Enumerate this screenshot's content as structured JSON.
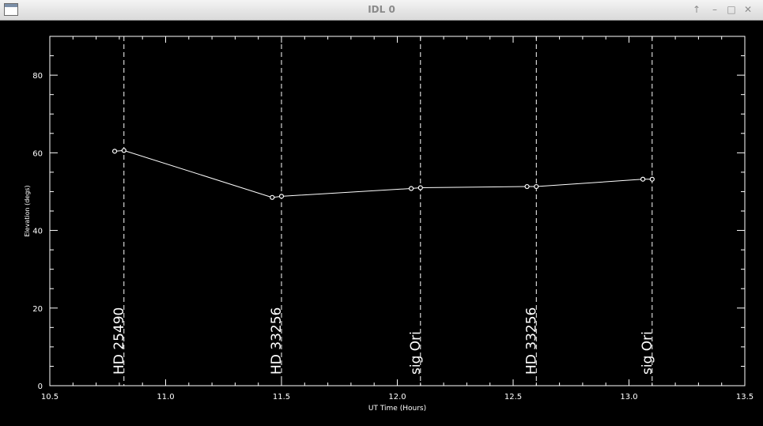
{
  "window": {
    "title": "IDL 0",
    "controls": {
      "up": "↑",
      "minimize": "–",
      "maximize": "□",
      "close": "✕"
    }
  },
  "chart_data": {
    "type": "line",
    "xlabel": "UT Time (Hours)",
    "ylabel": "Elevation (degs)",
    "xlim": [
      10.5,
      13.5
    ],
    "ylim": [
      0,
      90
    ],
    "x_ticks": [
      10.5,
      11.0,
      11.5,
      12.0,
      12.5,
      13.0,
      13.5
    ],
    "x_tick_labels": [
      "10.5",
      "11.0",
      "11.5",
      "12.0",
      "12.5",
      "13.0",
      "13.5"
    ],
    "y_ticks": [
      0,
      20,
      40,
      60,
      80
    ],
    "y_tick_labels": [
      "0",
      "20",
      "40",
      "60",
      "80"
    ],
    "grid": false,
    "background": "#000000",
    "foreground": "#ffffff",
    "series": [
      {
        "x": [
          10.78,
          10.82,
          11.46,
          11.5,
          12.06,
          12.1,
          12.56,
          12.6,
          13.06,
          13.1
        ],
        "y": [
          60.4,
          60.6,
          48.5,
          48.8,
          50.8,
          51.0,
          51.3,
          51.3,
          53.2,
          53.2
        ]
      }
    ],
    "annotations": [
      {
        "x": 10.82,
        "label": "HD 25490"
      },
      {
        "x": 11.5,
        "label": "HD 33256"
      },
      {
        "x": 12.1,
        "label": "sig Ori"
      },
      {
        "x": 12.6,
        "label": "HD 33256"
      },
      {
        "x": 13.1,
        "label": "sig Ori"
      }
    ]
  }
}
